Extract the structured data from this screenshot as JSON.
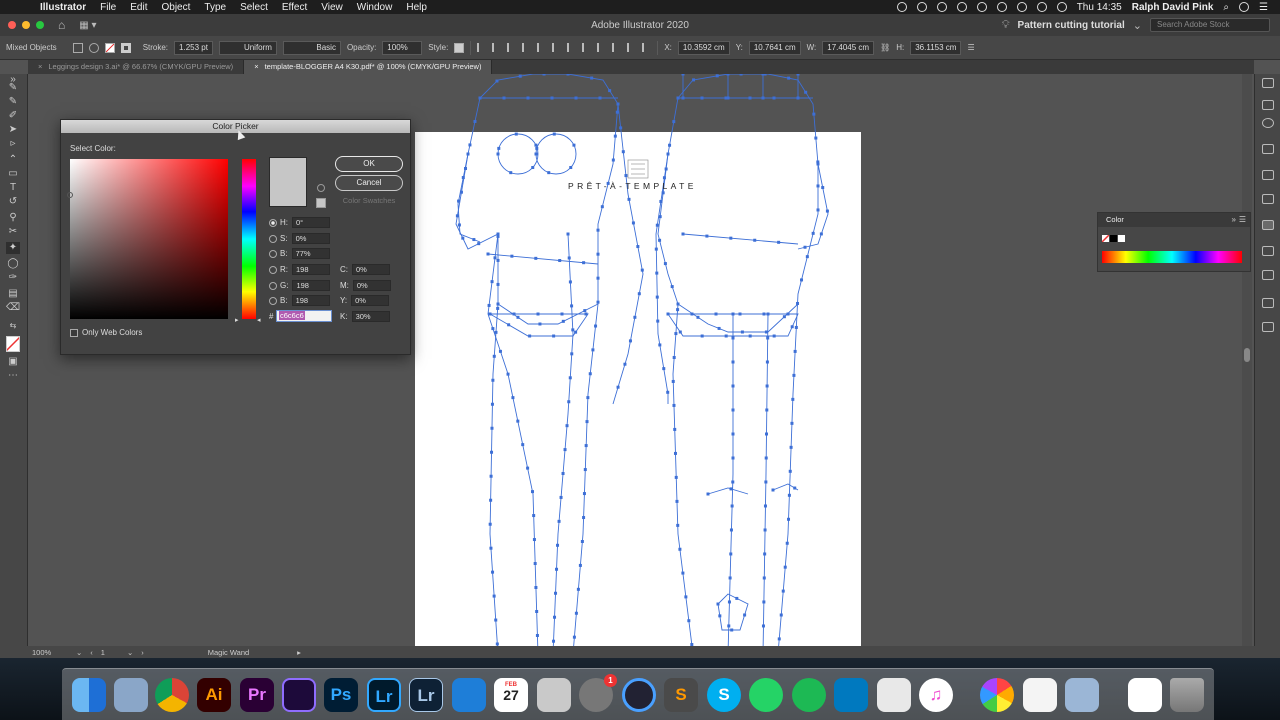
{
  "menubar": {
    "app": "Illustrator",
    "items": [
      "File",
      "Edit",
      "Object",
      "Type",
      "Select",
      "Effect",
      "View",
      "Window",
      "Help"
    ],
    "clock": "Thu 14:35",
    "user": "Ralph David Pink"
  },
  "appbar": {
    "title": "Adobe Illustrator 2020",
    "project": "Pattern cutting tutorial",
    "search_placeholder": "Search Adobe Stock"
  },
  "control": {
    "selection": "Mixed Objects",
    "stroke_label": "Stroke:",
    "stroke_value": "1.253 pt",
    "profile": "Uniform",
    "brush": "Basic",
    "opacity_label": "Opacity:",
    "opacity_value": "100%",
    "style_label": "Style:",
    "x_label": "X:",
    "x_value": "10.3592 cm",
    "y_label": "Y:",
    "y_value": "10.7641 cm",
    "w_label": "W:",
    "w_value": "17.4045 cm",
    "h_label": "H:",
    "h_value": "36.1153 cm"
  },
  "tabs": [
    {
      "label": "Leggings design 3.ai* @ 66.67% (CMYK/GPU Preview)"
    },
    {
      "label": "template-BLOGGER A4 K30.pdf* @ 100% (CMYK/GPU Preview)"
    }
  ],
  "canvas": {
    "brand": "PRÊT-À-TEMPLATE"
  },
  "status": {
    "zoom": "100%",
    "page": "1",
    "tool": "Magic Wand"
  },
  "color_picker": {
    "title": "Color Picker",
    "select_label": "Select Color:",
    "ok": "OK",
    "cancel": "Cancel",
    "swatches": "Color Swatches",
    "h_label": "H:",
    "h": "0°",
    "s_label": "S:",
    "s": "0%",
    "b_label": "B:",
    "b": "77%",
    "r_label": "R:",
    "r": "198",
    "g_label": "G:",
    "g": "198",
    "bl_label": "B:",
    "bl": "198",
    "c_label": "C:",
    "c": "0%",
    "m_label": "M:",
    "m": "0%",
    "y_label": "Y:",
    "y": "0%",
    "k_label": "K:",
    "k": "30%",
    "hex_label": "#",
    "hex": "c6c6c6",
    "web_only": "Only Web Colors",
    "preview_color": "#c6c6c6"
  },
  "color_panel": {
    "title": "Color"
  },
  "colors": {
    "accent_path": "#3d6fd6",
    "artboard": "#ffffff"
  },
  "dock": {
    "ai": "Ai",
    "pr": "Pr",
    "ps": "Ps",
    "lr": "Lr",
    "lr2": "Lr",
    "calendar_month": "FEB",
    "calendar_day": "27",
    "badge": "1"
  }
}
